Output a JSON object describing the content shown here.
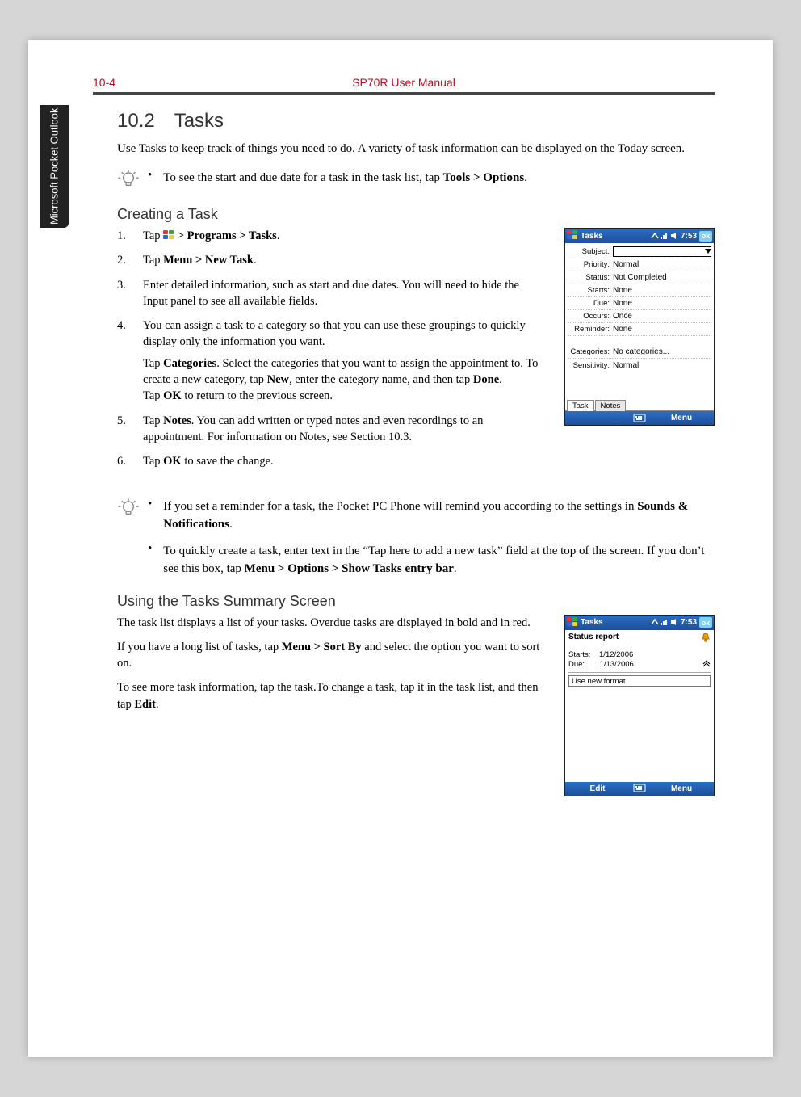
{
  "header": {
    "page_number": "10-4",
    "doc_title": "SP70R User Manual"
  },
  "sidebar": {
    "label": "Microsoft Pocket Outlook"
  },
  "section": {
    "heading": "10.2 Tasks",
    "intro": "Use Tasks to keep track of things you need to do. A variety of task information can be displayed on the Today screen.",
    "tip1_prefix": "To see the start and due date for a task in the task list, tap ",
    "tip1_bold": "Tools > Options",
    "tip1_suffix": ".",
    "creating_heading": "Creating a Task",
    "steps": {
      "s1_a": "Tap ",
      "s1_b": " > Programs > Tasks",
      "s1_c": ".",
      "s2_a": "Tap ",
      "s2_b": "Menu > New Task",
      "s2_c": ".",
      "s3": "Enter detailed information, such as start and due dates. You will need to hide the Input panel to see all available fields.",
      "s4_a": "You can assign a task to a category so that you can use these groupings to quickly display only the information you want.",
      "s4_b1": "Tap ",
      "s4_b2": "Categories",
      "s4_b3": ". Select the categories that you want to assign the appointment to. To create a new category, tap ",
      "s4_b4": "New",
      "s4_b5": ", enter the category name, and then tap ",
      "s4_b6": "Done",
      "s4_b7": ".",
      "s4_c1": "Tap ",
      "s4_c2": "OK",
      "s4_c3": " to return to the previous screen.",
      "s5_a": "Tap ",
      "s5_b": "Notes",
      "s5_c": ". You can add written or typed notes and even recordings to an appointment. For information on Notes, see Section 10.3.",
      "s6_a": "Tap ",
      "s6_b": "OK",
      "s6_c": " to save the change."
    },
    "tip2_a": "If you set a reminder for a task, the Pocket PC Phone will remind you according to the settings in ",
    "tip2_b": "Sounds & Notifications",
    "tip2_c": ".",
    "tip3_a": "To quickly create a task, enter text in the “Tap here to add a new task” field at the top of the screen. If you don’t see this box, tap ",
    "tip3_b": "Menu > Options > Show Tasks entry bar",
    "tip3_c": ".",
    "summary_heading": "Using the Tasks Summary Screen",
    "summary_p1": "The task list displays a list of your tasks. Overdue tasks are displayed in bold and in red.",
    "summary_p2_a": "If you have a long list of tasks, tap ",
    "summary_p2_b": "Menu > Sort By",
    "summary_p2_c": " and select the option you want to sort on.",
    "summary_p3_a": "To see more task information, tap the task.To change a task, tap it in the task list, and then tap ",
    "summary_p3_b": "Edit",
    "summary_p3_c": "."
  },
  "screenshot1": {
    "title": "Tasks",
    "time": "7:53",
    "ok": "ok",
    "labels": {
      "subject": "Subject:",
      "priority": "Priority:",
      "status": "Status:",
      "starts": "Starts:",
      "due": "Due:",
      "occurs": "Occurs:",
      "reminder": "Reminder:",
      "categories": "Categories:",
      "sensitivity": "Sensitivity:"
    },
    "values": {
      "priority": "Normal",
      "status": "Not Completed",
      "starts": "None",
      "due": "None",
      "occurs": "Once",
      "reminder": "None",
      "categories": "No categories...",
      "sensitivity": "Normal"
    },
    "tab_task": "Task",
    "tab_notes": "Notes",
    "soft_left": "",
    "soft_right": "Menu"
  },
  "screenshot2": {
    "title": "Tasks",
    "time": "7:53",
    "ok": "ok",
    "task_name": "Status report",
    "starts_label": "Starts:",
    "due_label": "Due:",
    "starts_val": "1/12/2006",
    "due_val": "1/13/2006",
    "quick_add": "Use new format",
    "soft_left": "Edit",
    "soft_right": "Menu"
  }
}
